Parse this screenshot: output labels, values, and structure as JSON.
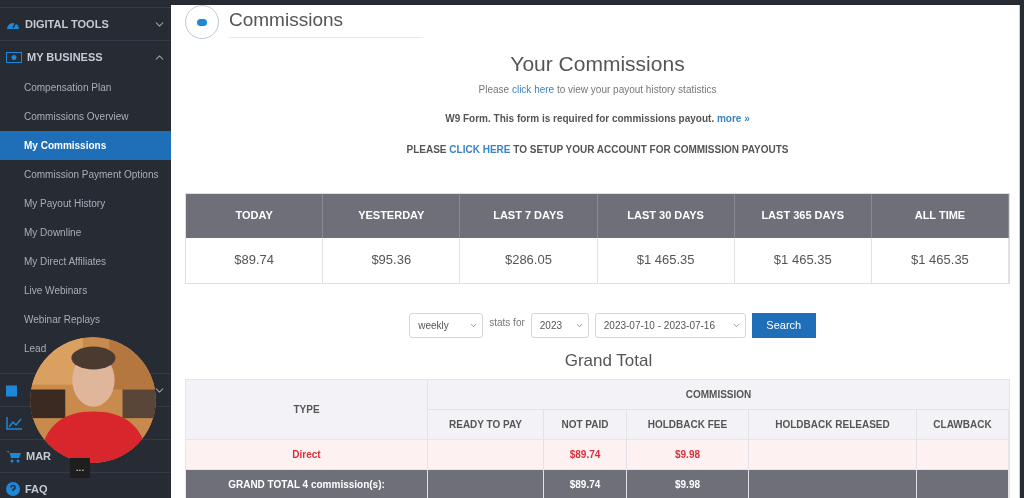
{
  "sidebar": {
    "sections": [
      {
        "kind": "gauge",
        "label": "DIGITAL TOOLS",
        "expanded": false
      },
      {
        "kind": "money",
        "label": "MY BUSINESS",
        "expanded": true,
        "children": [
          {
            "label": "Compensation Plan",
            "selected": false
          },
          {
            "label": "Commissions Overview",
            "selected": false
          },
          {
            "label": "My Commissions",
            "selected": true
          },
          {
            "label": "Commission Payment Options",
            "selected": false
          },
          {
            "label": "My Payout History",
            "selected": false
          },
          {
            "label": "My Downline",
            "selected": false
          },
          {
            "label": "My Direct Affiliates",
            "selected": false
          },
          {
            "label": "Live Webinars",
            "selected": false
          },
          {
            "label": "Webinar Replays",
            "selected": false
          },
          {
            "label": "Lead",
            "selected": false
          }
        ]
      },
      {
        "kind": "calendar",
        "expanded": false
      },
      {
        "kind": "chart"
      },
      {
        "kind": "cart",
        "label": "MAR"
      },
      {
        "kind": "help",
        "label": "FAQ"
      }
    ]
  },
  "video_overlay": {
    "kind": "picture",
    "menu": "..."
  },
  "page": {
    "title": "Commissions",
    "heading": "Your Commissions",
    "history_line": {
      "before": "Please",
      "link": "click here",
      "after": "to view your payout history statistics"
    },
    "w9_line": {
      "text": "W9 Form. This form is required for commissions payout.",
      "link": "more »"
    },
    "setup_line": {
      "before": "PLEASE",
      "link": "CLICK HERE",
      "after": "TO SETUP YOUR ACCOUNT FOR COMMISSION PAYOUTS"
    }
  },
  "stats": {
    "columns": [
      "TODAY",
      "YESTERDAY",
      "LAST 7 DAYS",
      "LAST 30 DAYS",
      "LAST 365 DAYS",
      "ALL TIME"
    ],
    "values": [
      "$89.74",
      "$95.36",
      "$286.05",
      "$1 465.35",
      "$1 465.35",
      "$1 465.35"
    ]
  },
  "filter": {
    "period": "weekly",
    "label": "stats for",
    "year": "2023",
    "range": "2023-07-10 - 2023-07-16",
    "button": "Search"
  },
  "grand_total": {
    "title": "Grand Total",
    "type_header": "TYPE",
    "group_header": "COMMISSION",
    "columns": [
      "READY TO PAY",
      "NOT PAID",
      "HOLDBACK FEE",
      "HOLDBACK RELEASED",
      "CLAWBACK"
    ],
    "rows": [
      {
        "kind": "direct",
        "type": "Direct",
        "cells": [
          "",
          "$89.74",
          "$9.98",
          "",
          ""
        ]
      },
      {
        "kind": "total",
        "type": "GRAND TOTAL 4 commission(s):",
        "cells": [
          "",
          "$89.74",
          "$9.98",
          "",
          ""
        ]
      }
    ]
  }
}
